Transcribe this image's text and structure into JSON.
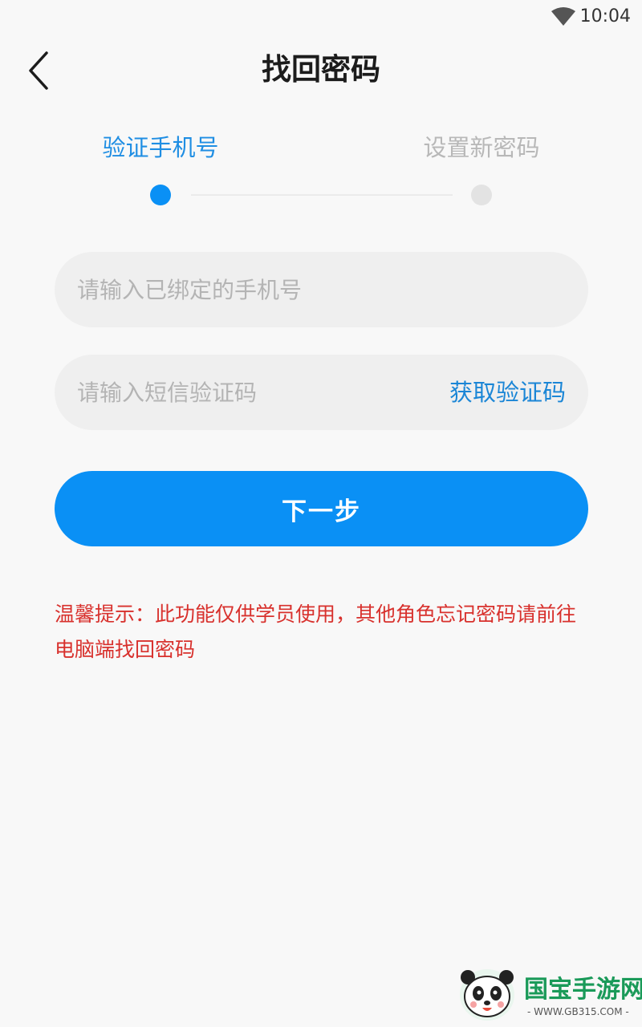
{
  "status_bar": {
    "time": "10:04",
    "wifi_icon": "wifi-icon"
  },
  "header": {
    "back_icon": "chevron-left-icon",
    "title": "找回密码"
  },
  "stepper": {
    "steps": [
      {
        "label": "验证手机号",
        "state": "active"
      },
      {
        "label": "设置新密码",
        "state": "inactive"
      }
    ],
    "active_color": "#0a90f5",
    "inactive_color": "#e3e3e3"
  },
  "form": {
    "phone_placeholder": "请输入已绑定的手机号",
    "phone_value": "",
    "code_placeholder": "请输入短信验证码",
    "code_value": "",
    "get_code_label": "获取验证码",
    "next_label": "下一步"
  },
  "tip": {
    "text": "温馨提示：此功能仅供学员使用，其他角色忘记密码请前往电脑端找回密码",
    "color": "#d8312d"
  },
  "watermark": {
    "brand": "国宝手游网",
    "url": "- WWW.GB315.COM -"
  },
  "colors": {
    "primary": "#0a90f5",
    "link": "#1b86d6",
    "background": "#f8f8f8",
    "field_background": "#efefef"
  }
}
